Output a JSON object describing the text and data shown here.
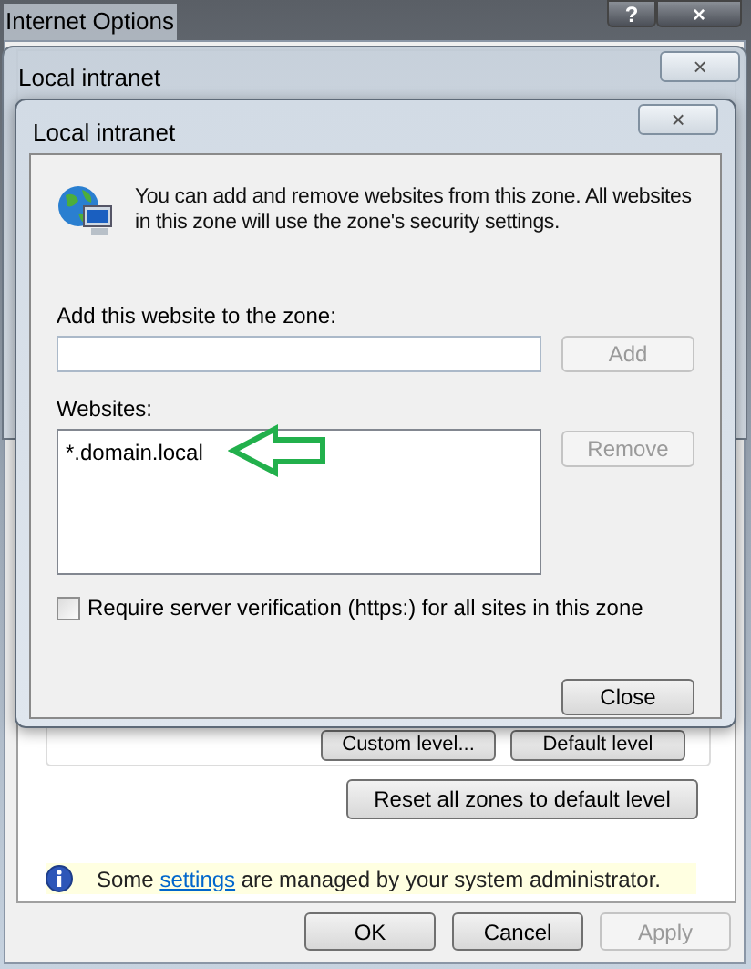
{
  "main_window": {
    "title": "Internet Options",
    "title_buttons": [
      "?",
      "×"
    ],
    "zone_buttons": [
      {
        "label": "Custom level..."
      },
      {
        "label": "Default level"
      }
    ],
    "reset_button": {
      "label": "Reset all zones to default level"
    },
    "info_bar": {
      "before": "Some ",
      "link": "settings",
      "after": " are managed by your system administrator."
    },
    "buttons": [
      {
        "label": "OK",
        "disabled": false
      },
      {
        "label": "Cancel",
        "disabled": false
      },
      {
        "label": "Apply",
        "disabled": true
      }
    ]
  },
  "middle_window": {
    "title": "Local intranet",
    "close": "×"
  },
  "dialog": {
    "title": "Local intranet",
    "close": "×",
    "description": "You can add and remove websites from this zone. All websites in this zone will use the zone's security settings.",
    "add_label": "Add this website to the zone:",
    "add_field": {
      "kind": "text"
    },
    "add_button": {
      "label": "Add",
      "disabled": true
    },
    "websites_label": "Websites:",
    "websites": [
      {
        "text": "*.domain.local",
        "selected": false
      }
    ],
    "remove_button": {
      "label": "Remove",
      "disabled": true
    },
    "require_https": {
      "label": "Require server verification (https:) for all sites in this zone",
      "checked": false
    },
    "close_button": {
      "label": "Close",
      "disabled": false
    }
  }
}
